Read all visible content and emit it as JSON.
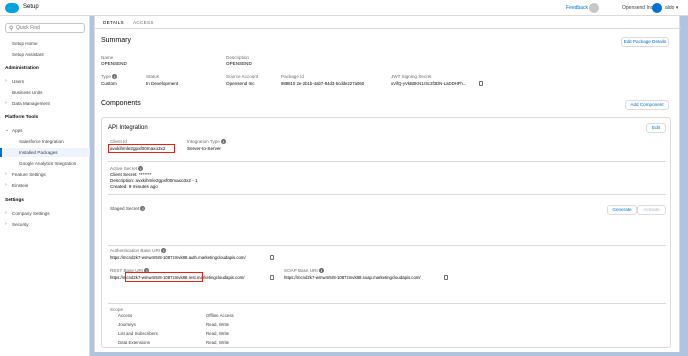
{
  "header": {
    "app_title": "Setup",
    "feedback": "Feedback",
    "org": "Opensend Inc ▾",
    "user": "aldo ▾"
  },
  "sidebar": {
    "search_placeholder": "Quick Find",
    "items": [
      {
        "label": "Setup Home"
      },
      {
        "label": "Setup Assistant"
      }
    ],
    "admin_title": "Administration",
    "admin_items": [
      {
        "label": "Users"
      },
      {
        "label": "Business Units"
      },
      {
        "label": "Data Management"
      }
    ],
    "platform_title": "Platform Tools",
    "platform_items": [
      {
        "label": "Apps"
      },
      {
        "label": "Salesforce Integration"
      },
      {
        "label": "Installed Packages"
      },
      {
        "label": "Google Analytics Integration"
      },
      {
        "label": "Feature Settings"
      },
      {
        "label": "Einstein"
      }
    ],
    "settings_title": "Settings",
    "settings_items": [
      {
        "label": "Company Settings"
      },
      {
        "label": "Security"
      }
    ]
  },
  "tabs": [
    "DETAILS",
    "ACCESS"
  ],
  "summary": {
    "title": "Summary",
    "edit_button": "Edit Package Details",
    "name_label": "Name",
    "name_value": "OPENSEND",
    "description_label": "Description",
    "description_value": "OPENSEND",
    "type_label": "Type",
    "type_value": "Custom",
    "status_label": "Status",
    "status_value": "In Development",
    "source_label": "Source Account",
    "source_value": "Opensend Inc",
    "package_id_label": "Package Id",
    "package_id_value": "988815 2e-2b1b-4ab7-84d3-5cdde227a060",
    "jwt_label": "JWT Signing Secret",
    "jwt_value": "xVifQ-yVkB0KN1rSc2f3DN-LaDDHFh..."
  },
  "components": {
    "title": "Components",
    "add_button": "Add Component"
  },
  "api": {
    "title": "API Integration",
    "edit_button": "Edit",
    "client_id_label": "Client Id",
    "client_id_value": "avxkihmle2gpxf00maxo3x2",
    "integration_type_label": "Integration Type",
    "integration_type_value": "Server-to-Server",
    "active_secret_label": "Active Secret",
    "active_secret_line1": "Client Secret: *******",
    "active_secret_line2": "Description: avxkihmle2gpxf00maxo3x2 - 1",
    "active_secret_line3": "Created: 9 minutes ago",
    "staged_secret_label": "Staged Secret",
    "generate_button": "Generate",
    "activate_button": "Activate",
    "auth_uri_label": "Authentication Base URI",
    "auth_uri_value": "https://mcnd2k7-wmw4r5r8-1087zmvk88.auth.marketingcloudapis.com/",
    "rest_uri_label": "REST Base URI",
    "rest_uri_value": "https://mcnd2k7-wmw4r5r8-1087zmvk88.rest.marketingcloudapis.com/",
    "soap_uri_label": "SOAP Base URI",
    "soap_uri_value": "https://mcnd2k7-wmw4r5r8-1087zmvk88.soap.marketingcloudapis.com/",
    "scope_label": "Scope",
    "scope": [
      {
        "name": "Access",
        "value": "Offline Access"
      },
      {
        "name": "Journeys",
        "value": "Read, Write"
      },
      {
        "name": "List and Subscribers",
        "value": "Read, Write"
      },
      {
        "name": "Data Extensions",
        "value": "Read, Write"
      }
    ]
  },
  "colors": {
    "brand": "#00a1e0",
    "link": "#0070d2",
    "highlight": "#e2231a",
    "background": "#b0c4df"
  }
}
